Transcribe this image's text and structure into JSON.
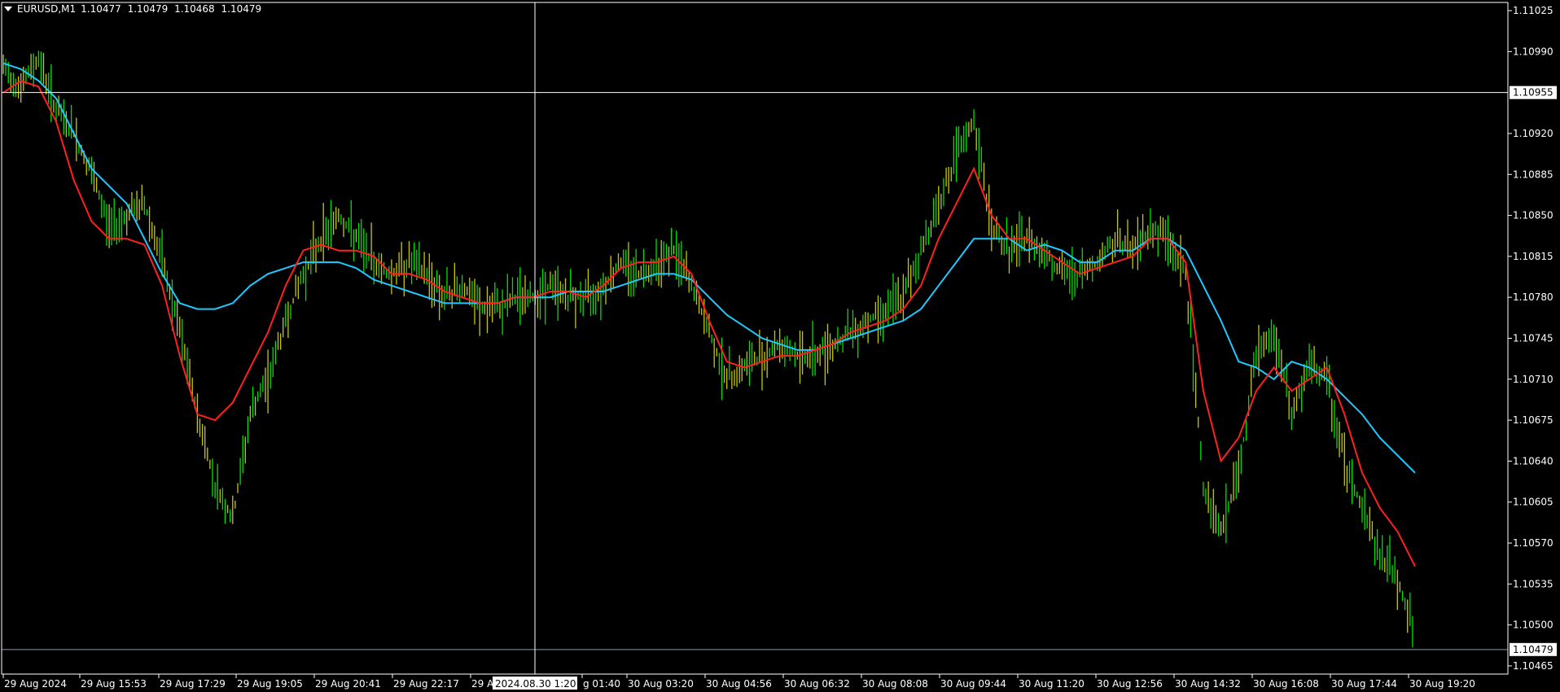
{
  "window": {
    "symbol": "EURUSD,M1",
    "quotes": [
      "1.10477",
      "1.10479",
      "1.10468",
      "1.10479"
    ]
  },
  "colors": {
    "background": "#000000",
    "frame": "#ffffff",
    "candle_up": "#00e000",
    "candle_down": "#c8c800",
    "ma_fast": "#ff2020",
    "ma_slow": "#20c8ff",
    "crosshair": "#ffffff",
    "current_price_line": "#8a9bb0",
    "time_label_bg": "#ffffff",
    "time_label_text": "#000000"
  },
  "chart_data": {
    "type": "line",
    "price_axis_labels": [
      "1.11025",
      "1.10990",
      "1.10920",
      "1.10885",
      "1.10850",
      "1.10815",
      "1.10780",
      "1.10745",
      "1.10710",
      "1.10675",
      "1.10640",
      "1.10605",
      "1.10570",
      "1.10535",
      "1.10500",
      "1.10465"
    ],
    "time_axis_labels": [
      "29 Aug 2024",
      "29 Aug 15:53",
      "29 Aug 17:29",
      "29 Aug 19:05",
      "29 Aug 20:41",
      "29 Aug 22:17",
      "29 A",
      "g 01:40",
      "30 Aug 03:20",
      "30 Aug 04:56",
      "30 Aug 06:32",
      "30 Aug 08:08",
      "30 Aug 09:44",
      "30 Aug 11:20",
      "30 Aug 12:56",
      "30 Aug 14:32",
      "30 Aug 16:08",
      "30 Aug 17:44",
      "30 Aug 19:20"
    ],
    "ylim": [
      1.10458,
      1.11032
    ],
    "crosshair": {
      "price": "1.10955",
      "price_value": 1.10955,
      "time": "2024.08.30 1:20"
    },
    "current_price": {
      "label": "1.10479",
      "value": 1.10479
    },
    "series": [
      {
        "role": "price_bars",
        "values": [
          1.10975,
          1.1096,
          1.10985,
          1.1094,
          1.1092,
          1.10885,
          1.1084,
          1.1085,
          1.1086,
          1.1081,
          1.1075,
          1.1068,
          1.1062,
          1.1059,
          1.1068,
          1.1071,
          1.1076,
          1.108,
          1.1083,
          1.1085,
          1.1083,
          1.1081,
          1.108,
          1.1081,
          1.108,
          1.1078,
          1.1079,
          1.1077,
          1.1077,
          1.1078,
          1.1078,
          1.1079,
          1.1078,
          1.1078,
          1.1079,
          1.1081,
          1.108,
          1.1081,
          1.1082,
          1.1079,
          1.1075,
          1.1071,
          1.1072,
          1.1073,
          1.1074,
          1.1073,
          1.1073,
          1.1074,
          1.1075,
          1.1076,
          1.1077,
          1.1078,
          1.1082,
          1.1086,
          1.109,
          1.1093,
          1.1084,
          1.1082,
          1.1083,
          1.1082,
          1.108,
          1.108,
          1.1081,
          1.1083,
          1.1082,
          1.1084,
          1.1083,
          1.108,
          1.1062,
          1.1058,
          1.1063,
          1.1073,
          1.1075,
          1.1068,
          1.1072,
          1.1071,
          1.1064,
          1.106,
          1.1056,
          1.1054,
          1.1049
        ]
      },
      {
        "role": "ma_fast",
        "values": [
          1.10955,
          1.10965,
          1.1096,
          1.1093,
          1.1088,
          1.10845,
          1.1083,
          1.1083,
          1.10825,
          1.1079,
          1.1073,
          1.1068,
          1.10675,
          1.1069,
          1.1072,
          1.1075,
          1.1079,
          1.1082,
          1.10825,
          1.1082,
          1.1082,
          1.10815,
          1.108,
          1.108,
          1.10795,
          1.10785,
          1.1078,
          1.10775,
          1.10775,
          1.1078,
          1.1078,
          1.10785,
          1.10785,
          1.1078,
          1.1079,
          1.10805,
          1.1081,
          1.1081,
          1.10815,
          1.108,
          1.1076,
          1.10725,
          1.1072,
          1.10725,
          1.1073,
          1.1073,
          1.10735,
          1.1074,
          1.1075,
          1.10755,
          1.1076,
          1.1077,
          1.1079,
          1.1083,
          1.1086,
          1.1089,
          1.1085,
          1.1083,
          1.1083,
          1.1082,
          1.1081,
          1.108,
          1.10805,
          1.1081,
          1.10815,
          1.1083,
          1.1083,
          1.1081,
          1.107,
          1.1064,
          1.1066,
          1.107,
          1.1072,
          1.107,
          1.1071,
          1.1072,
          1.1068,
          1.1063,
          1.106,
          1.1058,
          1.1055
        ]
      },
      {
        "role": "ma_slow",
        "values": [
          1.1098,
          1.10975,
          1.10965,
          1.1095,
          1.1092,
          1.1089,
          1.10875,
          1.1086,
          1.1083,
          1.108,
          1.10775,
          1.1077,
          1.1077,
          1.10775,
          1.1079,
          1.108,
          1.10805,
          1.1081,
          1.1081,
          1.1081,
          1.10805,
          1.10795,
          1.1079,
          1.10785,
          1.1078,
          1.10775,
          1.10775,
          1.10775,
          1.10775,
          1.1078,
          1.1078,
          1.1078,
          1.10785,
          1.10785,
          1.10785,
          1.1079,
          1.10795,
          1.108,
          1.108,
          1.10795,
          1.1078,
          1.10765,
          1.10755,
          1.10745,
          1.1074,
          1.10735,
          1.10735,
          1.1074,
          1.10745,
          1.1075,
          1.10755,
          1.1076,
          1.1077,
          1.1079,
          1.1081,
          1.1083,
          1.1083,
          1.1083,
          1.1082,
          1.10825,
          1.1082,
          1.1081,
          1.1081,
          1.1082,
          1.1082,
          1.1083,
          1.1083,
          1.1082,
          1.1079,
          1.1076,
          1.10725,
          1.1072,
          1.1071,
          1.10725,
          1.1072,
          1.1071,
          1.10695,
          1.1068,
          1.1066,
          1.10645,
          1.1063
        ]
      }
    ]
  }
}
